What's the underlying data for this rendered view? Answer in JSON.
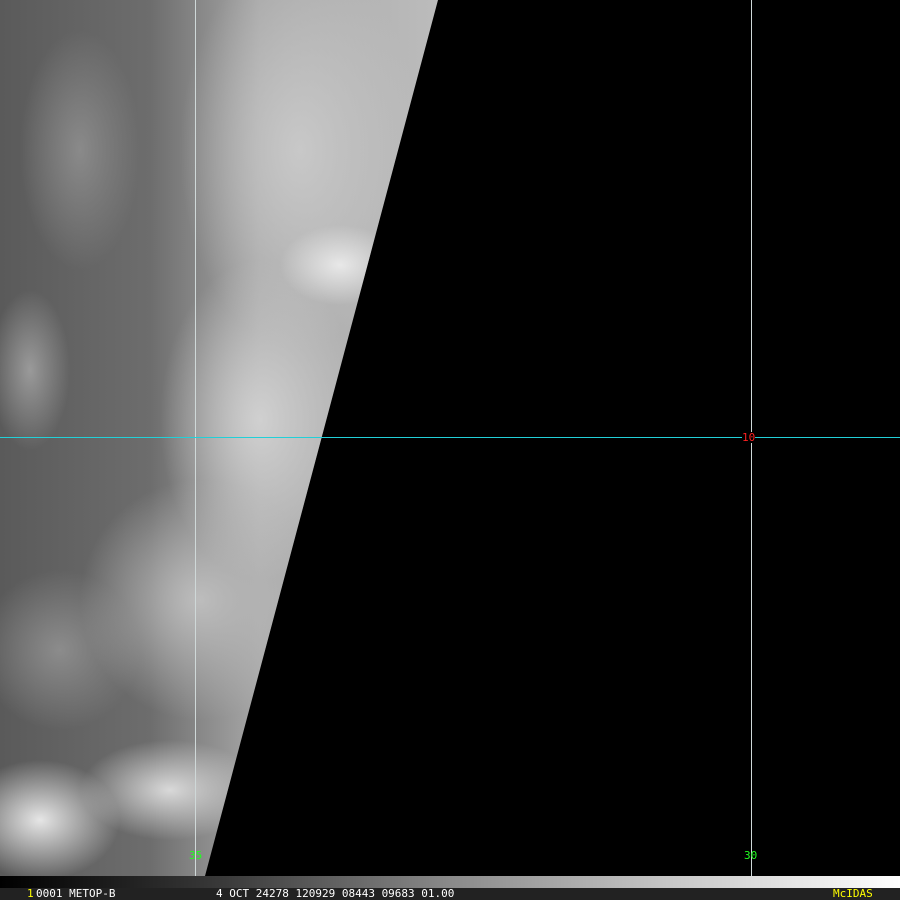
{
  "grid": {
    "lat_label": "10",
    "lon_labels": [
      "35",
      "30"
    ],
    "line_color": "#22d0d8",
    "lat_label_color": "#ff2020",
    "lon_label_color": "#20ff20"
  },
  "status": {
    "frame": "1",
    "text": "0001 METOP-B",
    "date_info": "4 OCT 24278 120929 08443 09683 01.00",
    "brand": "McIDAS"
  }
}
